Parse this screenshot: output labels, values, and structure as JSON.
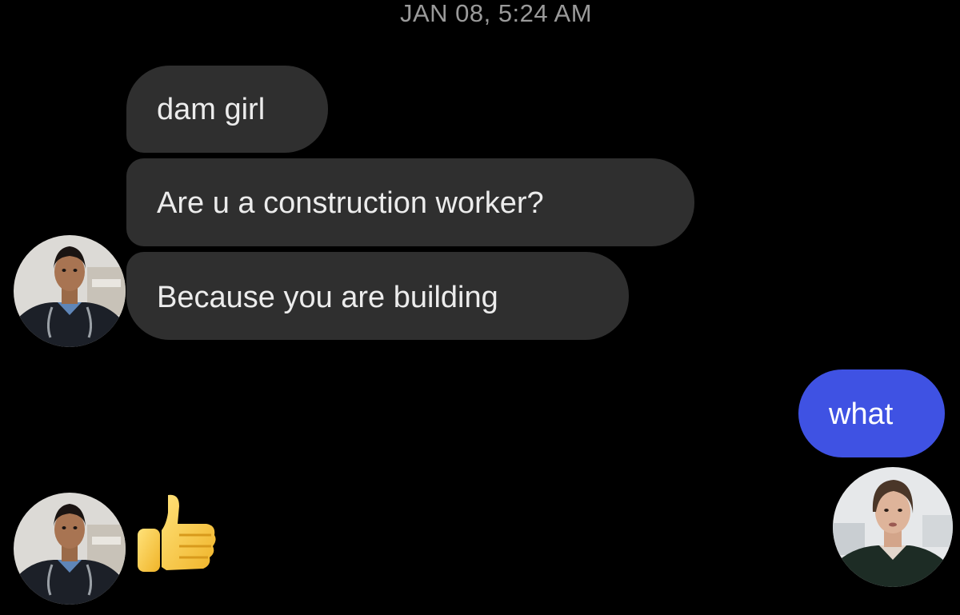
{
  "conversation": {
    "timestamp": "JAN 08, 5:24 AM",
    "messages": [
      {
        "from": "other",
        "text": "dam girl"
      },
      {
        "from": "other",
        "text": "Are u a construction worker?"
      },
      {
        "from": "other",
        "text": "Because you are building"
      },
      {
        "from": "me",
        "text": "what"
      },
      {
        "from": "other",
        "emoji": "thumbs-up-icon"
      }
    ]
  },
  "colors": {
    "background": "#000000",
    "received_bubble": "#2f2f2f",
    "sent_bubble": "#3f52e3",
    "timestamp_text": "#9a9a9a"
  }
}
